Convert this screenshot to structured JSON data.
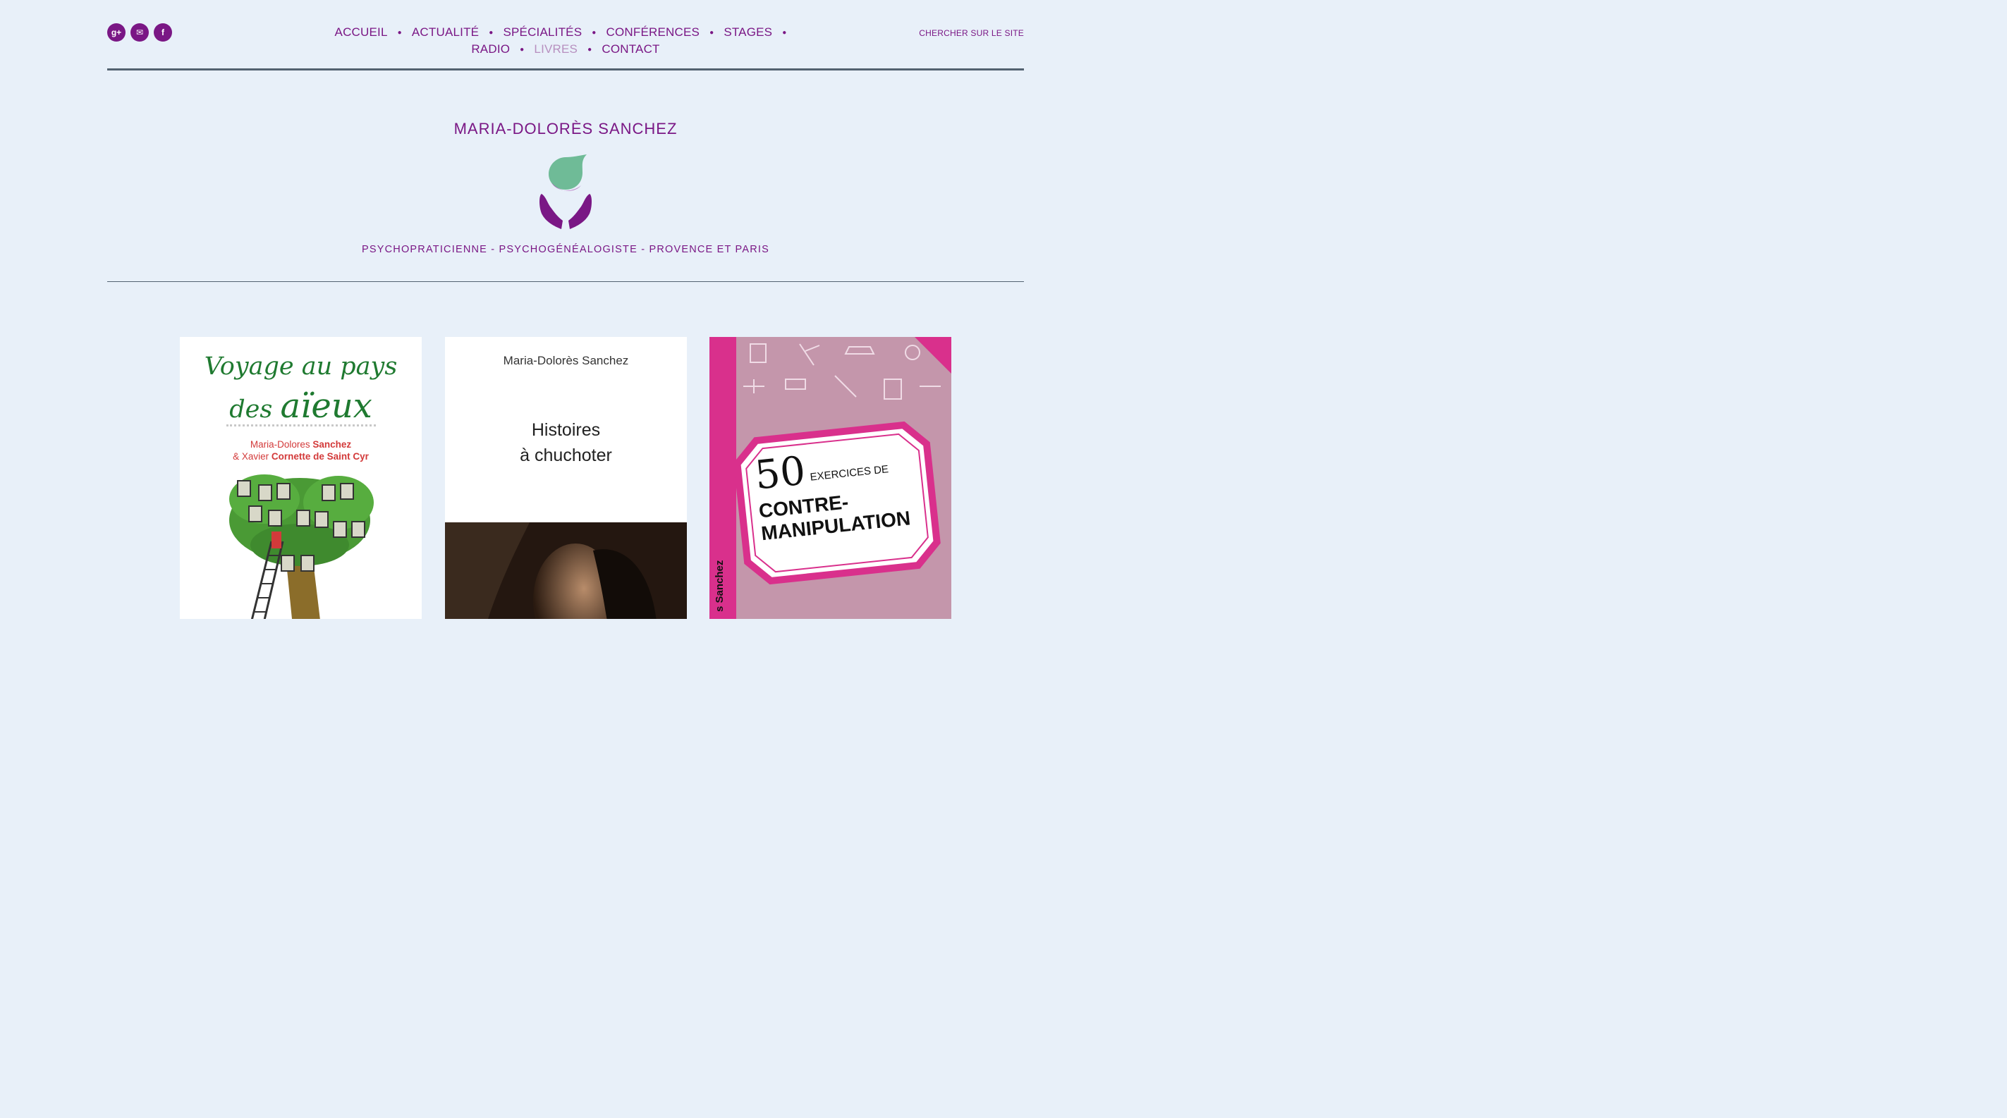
{
  "social": [
    {
      "name": "google-plus-icon",
      "glyph": "g+"
    },
    {
      "name": "email-icon",
      "glyph": "✉"
    },
    {
      "name": "facebook-icon",
      "glyph": "f"
    }
  ],
  "nav": {
    "row1": [
      "ACCUEIL",
      "ACTUALITÉ",
      "SPÉCIALITÉS",
      "CONFÉRENCES",
      "STAGES"
    ],
    "row2": [
      "RADIO",
      "LIVRES",
      "CONTACT"
    ],
    "active": "LIVRES"
  },
  "search_label": "CHERCHER SUR LE SITE",
  "site_title": "MARIA-DOLORÈS SANCHEZ",
  "tagline": "PSYCHOPRATICIENNE - PSYCHOGÉNÉALOGISTE - PROVENCE ET PARIS",
  "books": [
    {
      "title_line1": "Voyage au pays",
      "title_line2_small": "des",
      "title_line2_big": "aïeux",
      "author_line1_prefix": "Maria-Dolores",
      "author_line1_name": "Sanchez",
      "author_line2_prefix": "& Xavier",
      "author_line2_name": "Cornette de Saint Cyr"
    },
    {
      "author": "Maria-Dolorès Sanchez",
      "title_line1": "Histoires",
      "title_line2": "à chuchoter"
    },
    {
      "number": "50",
      "subtitle": "EXERCICES DE",
      "title_line1": "CONTRE-",
      "title_line2": "MANIPULATION",
      "spine": "s Sanchez"
    }
  ],
  "colors": {
    "background": "#e8f0f9",
    "brand_purple": "#7a1785",
    "active_link": "#b78fbf",
    "rule": "#536270",
    "drop_green": "#6fbb97",
    "book3_pink": "#d9308c"
  }
}
